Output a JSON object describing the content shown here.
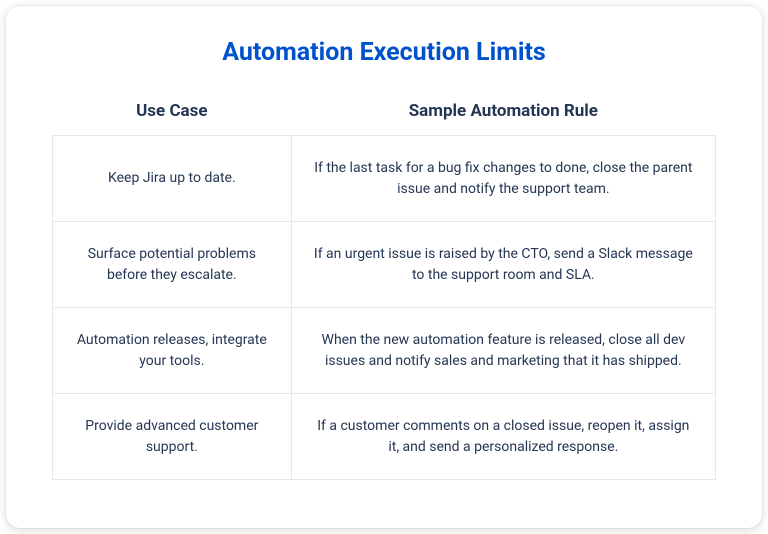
{
  "title": "Automation Execution Limits",
  "table": {
    "headers": {
      "usecase": "Use Case",
      "rule": "Sample Automation Rule"
    },
    "rows": [
      {
        "usecase": "Keep Jira up to date.",
        "rule": "If the last task for a bug fix changes to done, close the parent issue and notify the support team."
      },
      {
        "usecase": "Surface potential problems before they escalate.",
        "rule": "If an urgent issue is raised by the CTO, send a Slack message to the support room and SLA."
      },
      {
        "usecase": "Automation releases, integrate your tools.",
        "rule": "When the new automation feature is released, close all dev issues and notify sales and marketing that it has shipped."
      },
      {
        "usecase": "Provide advanced customer support.",
        "rule": "If a customer comments on a closed issue, reopen it, assign it, and send a personalized response."
      }
    ]
  }
}
